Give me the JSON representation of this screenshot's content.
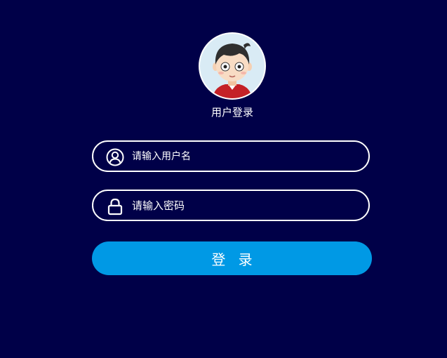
{
  "login": {
    "title": "用户登录",
    "username": {
      "placeholder": "请输入用户名",
      "value": "",
      "icon": "user-icon"
    },
    "password": {
      "placeholder": "请输入密码",
      "value": "",
      "icon": "lock-icon"
    },
    "submit_label": "登 录"
  },
  "colors": {
    "background": "#000048",
    "button": "#0099e5",
    "text": "#ffffff"
  }
}
